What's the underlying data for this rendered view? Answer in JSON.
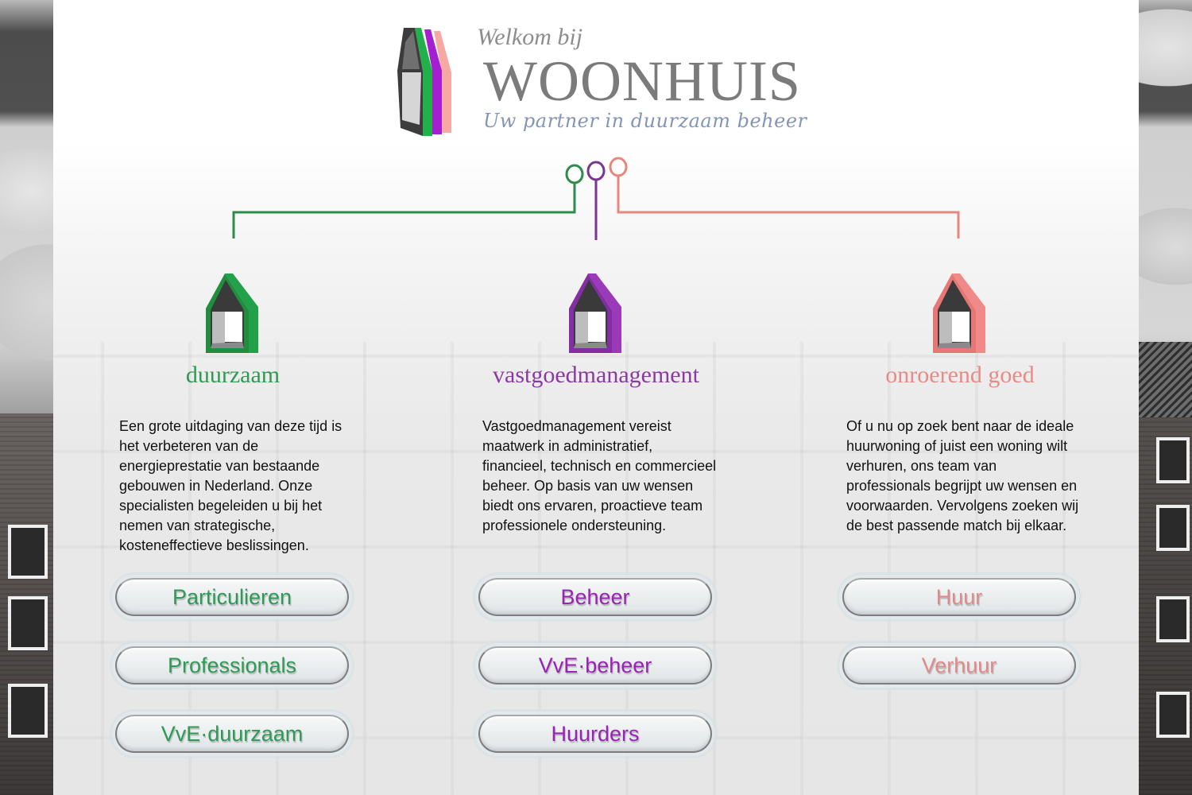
{
  "header": {
    "welcome": "Welkom bij",
    "brand": "WOONHUIS",
    "tagline": "Uw partner in duurzaam beheer",
    "logo_icon": "house-stack-logo-icon"
  },
  "colors": {
    "green": "#2a9a4a",
    "purple": "#8a2fa0",
    "pink": "#e98a85",
    "text": "#111111",
    "brand_gray": "#7b7b7b",
    "tagline_blue": "#8595b5"
  },
  "tree": {
    "nodes": [
      "green",
      "purple",
      "pink"
    ],
    "icon": "connector-ring-icon"
  },
  "columns": [
    {
      "id": "duurzaam",
      "title": "duurzaam",
      "icon": "house-icon",
      "description": "Een grote uitdaging van deze tijd is het verbeteren van de energieprestatie van bestaande gebouwen in Nederland. Onze specialisten begeleiden u bij het nemen van strategische, kosteneffectieve beslissingen.",
      "buttons": [
        "Particulieren",
        "Professionals",
        "VvE·duurzaam"
      ]
    },
    {
      "id": "vastgoedmanagement",
      "title": "vastgoedmanagement",
      "icon": "house-icon",
      "description": "Vastgoedmanagement vereist maatwerk in administratief, financieel, technisch en commercieel beheer. Op basis van uw wensen biedt ons ervaren, proactieve team professionele ondersteuning.",
      "buttons": [
        "Beheer",
        "VvE·beheer",
        "Huurders"
      ]
    },
    {
      "id": "onroerend-goed",
      "title": "onroerend goed",
      "icon": "house-icon",
      "description": "Of u nu op zoek bent naar de ideale huurwoning of juist een woning wilt verhuren, ons team van professionals begrijpt uw wensen en voorwaarden. Vervolgens zoeken wij de best passende match bij elkaar.",
      "buttons": [
        "Huur",
        "Verhuur"
      ]
    }
  ]
}
